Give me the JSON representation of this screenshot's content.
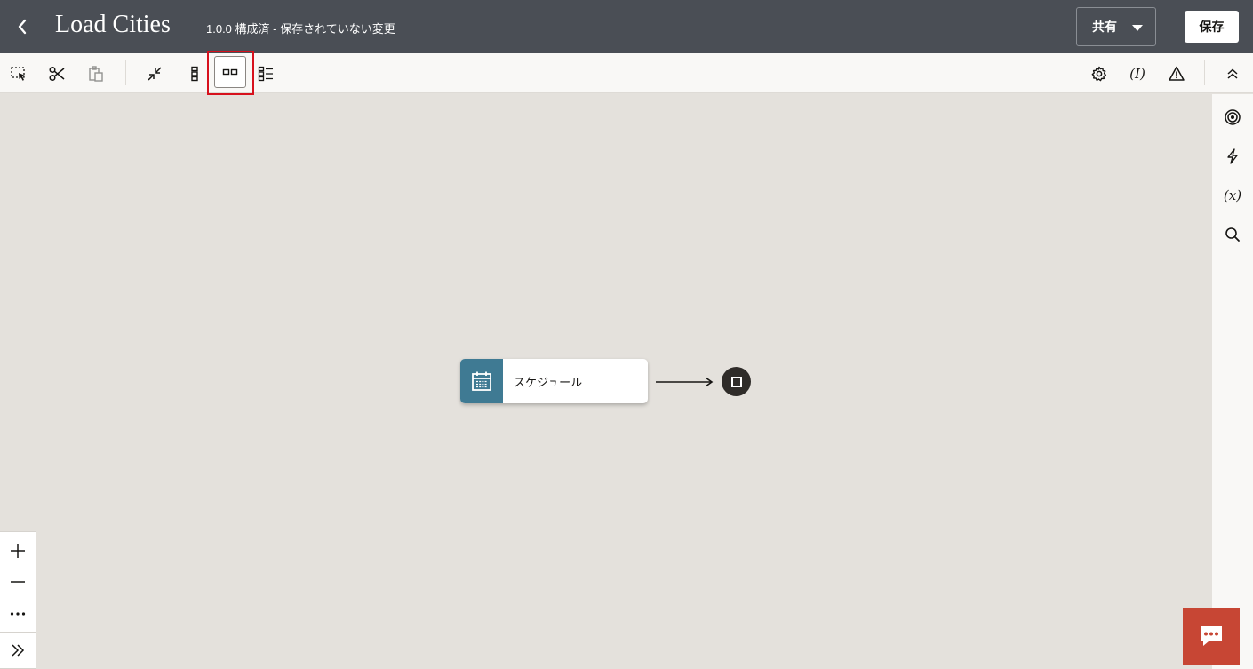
{
  "header": {
    "title": "Load Cities",
    "subtitle": "1.0.0 構成済 - 保存されていない変更",
    "share_label": "共有",
    "save_label": "保存"
  },
  "toolbar": {
    "left_icons": [
      "select-icon",
      "cut-icon",
      "paste-icon",
      "collapse-icon",
      "vertical-layout-icon",
      "horizontal-layout-icon",
      "card-layout-icon"
    ],
    "active_icon": "horizontal-layout-icon",
    "right_icons": [
      "gear-icon",
      "integration-properties-icon",
      "warning-icon",
      "chevron-up-icon"
    ],
    "integration_properties_text": "(I)"
  },
  "right_rail": {
    "icons": [
      "target-icon",
      "lightning-icon",
      "variable-icon",
      "search-icon"
    ],
    "variable_text": "(x)"
  },
  "zoom": {
    "icons": [
      "zoom-in-icon",
      "zoom-out-icon",
      "more-icon",
      "expand-icon"
    ]
  },
  "canvas": {
    "node_label": "スケジュール",
    "node_icon": "calendar-icon",
    "node_color": "#3f7a93",
    "end_icon": "stop-icon"
  },
  "colors": {
    "header_bg": "#4a4e55",
    "accent_red": "#c74634",
    "highlight": "#d7111d",
    "canvas_bg": "#e4e1dc"
  }
}
